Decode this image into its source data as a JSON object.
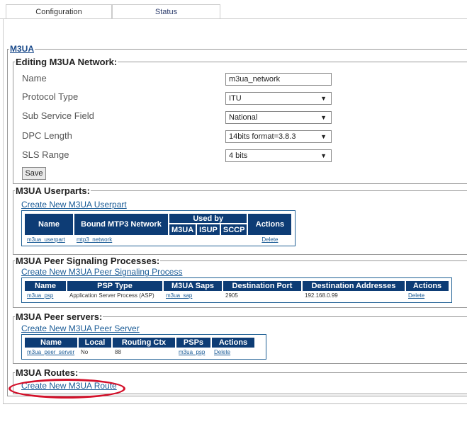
{
  "tabs": [
    {
      "label": "Configuration"
    },
    {
      "label": "Status"
    }
  ],
  "m3ua_legend": "M3UA",
  "edit": {
    "legend": "Editing M3UA Network:",
    "fields": [
      {
        "label": "Name",
        "value": "m3ua_network",
        "type": "text"
      },
      {
        "label": "Protocol Type",
        "value": "ITU",
        "type": "select"
      },
      {
        "label": "Sub Service Field",
        "value": "National",
        "type": "select"
      },
      {
        "label": "DPC Length",
        "value": "14bits format=3.8.3",
        "type": "select"
      },
      {
        "label": "SLS Range",
        "value": "4 bits",
        "type": "select"
      }
    ],
    "save_label": "Save"
  },
  "userparts": {
    "legend": "M3UA Userparts:",
    "create_link": "Create New M3UA Userpart",
    "headers": {
      "name": "Name",
      "bound": "Bound MTP3 Network",
      "used_by": "Used by",
      "m3ua": "M3UA",
      "isup": "ISUP",
      "sccp": "SCCP",
      "actions": "Actions"
    },
    "row": {
      "name": "m3ua_userpart",
      "bound": "mtp3_network",
      "action": "Delete"
    }
  },
  "peer_processes": {
    "legend": "M3UA Peer Signaling Processes:",
    "create_link": "Create New M3UA Peer Signaling Process",
    "headers": [
      "Name",
      "PSP Type",
      "M3UA Saps",
      "Destination Port",
      "Destination Addresses",
      "Actions"
    ],
    "row": {
      "name": "m3ua_psp",
      "type": "Application Server Process (ASP)",
      "saps": "m3ua_sap",
      "port": "2905",
      "address": "192.168.0.99",
      "action": "Delete"
    }
  },
  "peer_servers": {
    "legend": "M3UA Peer servers:",
    "create_link": "Create New M3UA Peer Server",
    "headers": [
      "Name",
      "Local",
      "Routing Ctx",
      "PSPs",
      "Actions"
    ],
    "row": {
      "name": "m3ua_peer_server",
      "local": "No",
      "routing": "88",
      "psps": "m3ua_psp",
      "action": "Delete"
    }
  },
  "routes": {
    "legend": "M3UA Routes:",
    "create_link": "Create New M3UA Route"
  },
  "colors": {
    "header_bg": "#0d3c75",
    "link": "#1a5b96",
    "highlight": "#d4102a"
  }
}
